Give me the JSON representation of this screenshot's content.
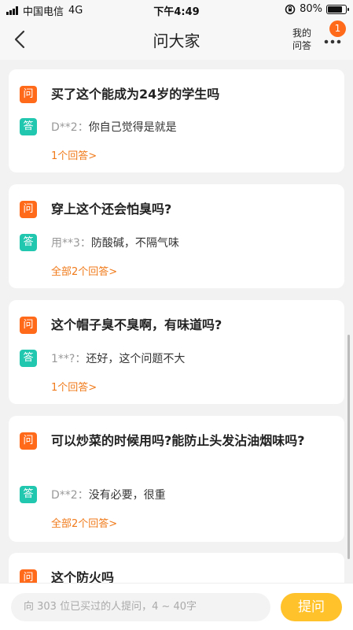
{
  "status_bar": {
    "carrier": "中国电信",
    "network": "4G",
    "time": "下午4:49",
    "battery": "80%",
    "battery_level": 0.8
  },
  "nav": {
    "title": "问大家",
    "my_answers_line1": "我的",
    "my_answers_line2": "问答",
    "badge_count": "1"
  },
  "tags": {
    "question": "问",
    "answer": "答"
  },
  "questions": [
    {
      "title": "买了这个能成为24岁的学生吗",
      "answer_user": "D**2：",
      "answer_text": "你自己觉得是就是",
      "more": "1个回答>"
    },
    {
      "title": "穿上这个还会怕臭吗?",
      "answer_user": "用**3：",
      "answer_text": "防酸碱，不隔气味",
      "more": "全部2个回答>"
    },
    {
      "title": "这个帽子臭不臭啊，有味道吗?",
      "answer_user": "1**?：",
      "answer_text": "还好，这个问题不大",
      "more": "1个回答>"
    },
    {
      "title": "可以炒菜的时候用吗?能防止头发沾油烟味吗?",
      "answer_user": "D**2：",
      "answer_text": "没有必要，很重",
      "more": "全部2个回答>"
    },
    {
      "title": "这个防火吗"
    }
  ],
  "bottom": {
    "placeholder": "向 303 位已买过的人提问，4 ~ 40字",
    "ask_label": "提问"
  },
  "colors": {
    "question_tag": "#ff6a1a",
    "answer_tag": "#22c7b0",
    "link": "#f07a1a",
    "ask_button": "#ffc22b"
  }
}
